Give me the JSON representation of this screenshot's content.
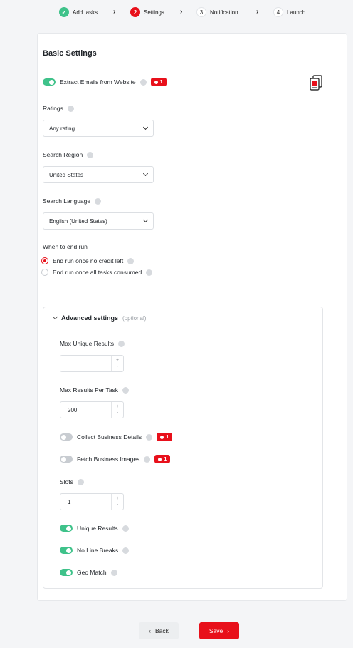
{
  "stepper": {
    "steps": [
      {
        "num": "✓",
        "label": "Add tasks",
        "state": "done"
      },
      {
        "num": "2",
        "label": "Settings",
        "state": "active"
      },
      {
        "num": "3",
        "label": "Notification",
        "state": "todo"
      },
      {
        "num": "4",
        "label": "Launch",
        "state": "todo"
      }
    ],
    "separator": "›"
  },
  "basic": {
    "title": "Basic Settings",
    "extract_emails": {
      "label": "Extract Emails from Website",
      "enabled": true,
      "badge": "1"
    },
    "ratings": {
      "label": "Ratings",
      "value": "Any rating"
    },
    "region": {
      "label": "Search Region",
      "value": "United States"
    },
    "language": {
      "label": "Search Language",
      "value": "English (United States)"
    },
    "end_run": {
      "label": "When to end run",
      "options": [
        {
          "label": "End run once no credit left",
          "checked": true
        },
        {
          "label": "End run once all tasks consumed",
          "checked": false
        }
      ]
    }
  },
  "advanced": {
    "title": "Advanced settings",
    "optional": "(optional)",
    "max_unique": {
      "label": "Max Unique Results",
      "value": ""
    },
    "max_per_task": {
      "label": "Max Results Per Task",
      "value": "200"
    },
    "collect_details": {
      "label": "Collect Business Details",
      "enabled": false,
      "badge": "1"
    },
    "fetch_images": {
      "label": "Fetch Business Images",
      "enabled": false,
      "badge": "1"
    },
    "slots": {
      "label": "Slots",
      "value": "1"
    },
    "unique_results": {
      "label": "Unique Results",
      "enabled": true
    },
    "no_line_breaks": {
      "label": "No Line Breaks",
      "enabled": true
    },
    "geo_match": {
      "label": "Geo Match",
      "enabled": true
    },
    "stepper_plus": "+",
    "stepper_minus": "-"
  },
  "footer": {
    "back_label": "Back",
    "back_icon": "‹",
    "save_label": "Save",
    "save_icon": "›"
  },
  "colors": {
    "accent": "#e8101b",
    "success": "#3fc28a"
  }
}
